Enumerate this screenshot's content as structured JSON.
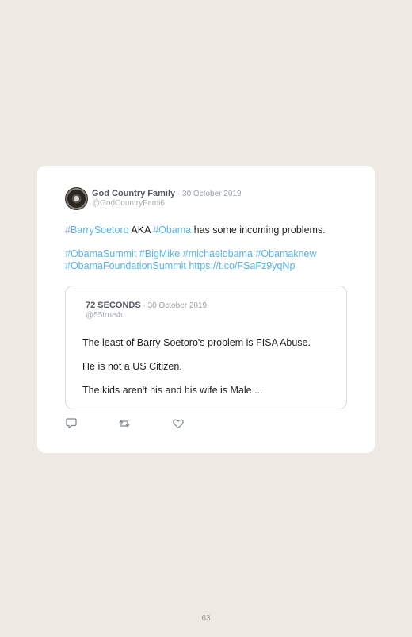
{
  "tweet": {
    "author_name": "God Country Family",
    "separator": " · ",
    "date": "30 October 2019",
    "handle": "@GodCountryFami6",
    "line1": [
      {
        "text": "#BarrySoetoro",
        "hashtag": true
      },
      {
        "text": " AKA ",
        "hashtag": false
      },
      {
        "text": "#Obama",
        "hashtag": true
      },
      {
        "text": " has some incoming problems.",
        "hashtag": false
      }
    ],
    "line2": "#ObamaSummit #BigMike #michaelobama #Obamaknew",
    "line3": "#ObamaFoundationSummit https://t.co/FSaFz9yqNp"
  },
  "quoted_tweet": {
    "author_name": "72 SECONDS",
    "separator": " · ",
    "date": "30 October 2019",
    "handle": "@55true4u",
    "paragraphs": [
      "The least of Barry Soetoro's problem is FISA Abuse.",
      "He is not a US Citizen.",
      "The kids aren't his and his wife is Male ..."
    ]
  },
  "actions": [
    {
      "icon": "reply-icon"
    },
    {
      "icon": "retweet-icon"
    },
    {
      "icon": "like-icon"
    }
  ],
  "colors": {
    "background": "#efe9e3",
    "card": "#ffffff",
    "hashtag": "#58b4e6"
  },
  "page_number": "63"
}
